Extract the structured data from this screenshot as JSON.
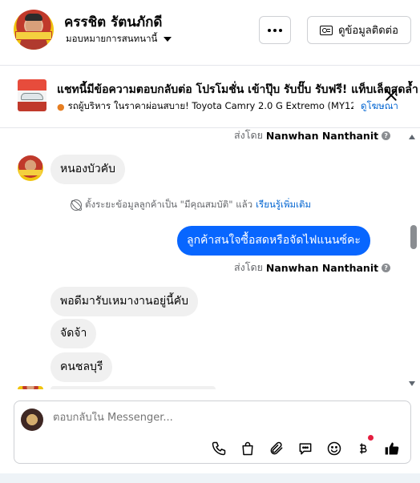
{
  "header": {
    "contact_name": "ครรชิต รัตนภักดี",
    "assign_label": "มอบหมายการสนทนานี้",
    "more_label": "…",
    "info_button_label": "ดูข้อมูลติดต่อ"
  },
  "ad_banner": {
    "title": "แชทนี้มีข้อความตอบกลับต่อ โปรโมชั่น เข้าปุ๊บ รับปั๊บ รับฟรี! แท็บเล็ตสุดล้ำ",
    "subtitle": "รถผู้บริหาร ในราคาผ่อนสบาย! Toyota Camry 2.0 G Extremo (MY12...",
    "link_label": "ดูโฆษณา"
  },
  "messages": {
    "sent_by_prefix": "ส่งโดย",
    "sender_name": "Nanwhan Nanthanit",
    "msg_1": "หนองบัวคับ",
    "system_text": "ตั้งระยะข้อมูลลูกค้าเป็น \"มีคุณสมบัติ\" แล้ว",
    "system_link": "เรียนรู้เพิ่มเติม",
    "msg_out_1": "ลูกค้าสนใจซื้อสดหรือจัดไฟแนนซ์คะ",
    "msg_2": "พอดีมารับเหมางานอยู่นี้คับ",
    "msg_3": "จัดจ้า",
    "msg_4": "คนชลบุรี"
  },
  "composer": {
    "placeholder": "ตอบกลับใน Messenger...",
    "icons": [
      "phone-icon",
      "shopping-bag-icon",
      "paperclip-icon",
      "quick-reply-icon",
      "emoji-icon",
      "payment-icon",
      "thumbs-up-icon"
    ]
  },
  "colors": {
    "accent": "#0866ff",
    "link": "#0064d1",
    "incoming_bubble": "#f0f0f0",
    "notification_dot": "#e41e3f"
  }
}
